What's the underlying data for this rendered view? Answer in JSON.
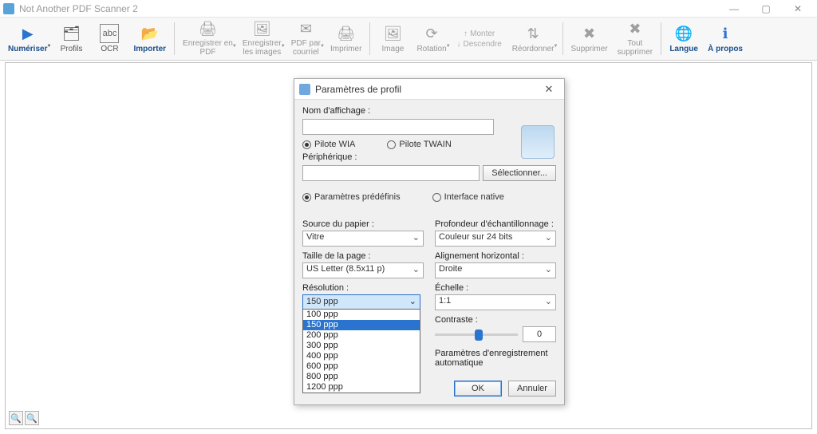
{
  "window": {
    "title": "Not Another PDF Scanner 2"
  },
  "toolbar": {
    "scan": "Numériser",
    "profiles": "Profils",
    "ocr": "OCR",
    "import": "Importer",
    "save_pdf": "Enregistrer en\nPDF",
    "save_images": "Enregistrer\nles images",
    "pdf_email": "PDF par\ncourriel",
    "print": "Imprimer",
    "image": "Image",
    "rotation": "Rotation",
    "move_up": "Monter",
    "move_down": "Descendre",
    "reorder": "Réordonner",
    "delete": "Supprimer",
    "delete_all": "Tout\nsupprimer",
    "language": "Langue",
    "about": "À propos"
  },
  "dialog": {
    "title": "Paramètres de profil",
    "display_name_label": "Nom d'affichage :",
    "display_name_value": "",
    "driver_wia": "Pilote WIA",
    "driver_twain": "Pilote TWAIN",
    "device_label": "Périphérique :",
    "device_value": "",
    "select_btn": "Sélectionner...",
    "preset_params": "Paramètres prédéfinis",
    "native_ui": "Interface native",
    "paper_source_label": "Source du papier :",
    "paper_source_value": "Vitre",
    "page_size_label": "Taille de la page :",
    "page_size_value": "US Letter (8.5x11 p)",
    "resolution_label": "Résolution :",
    "resolution_value": "150 ppp",
    "resolution_options": [
      "100 ppp",
      "150 ppp",
      "200 ppp",
      "300 ppp",
      "400 ppp",
      "600 ppp",
      "800 ppp",
      "1200 ppp"
    ],
    "bit_depth_label": "Profondeur d'échantillonnage :",
    "bit_depth_value": "Couleur sur 24 bits",
    "h_align_label": "Alignement horizontal :",
    "h_align_value": "Droite",
    "scale_label": "Échelle :",
    "scale_value": "1:1",
    "contrast_label": "Contraste :",
    "contrast_value": "0",
    "autosave_label": "Paramètres d'enregistrement automatique",
    "ok": "OK",
    "cancel": "Annuler"
  }
}
